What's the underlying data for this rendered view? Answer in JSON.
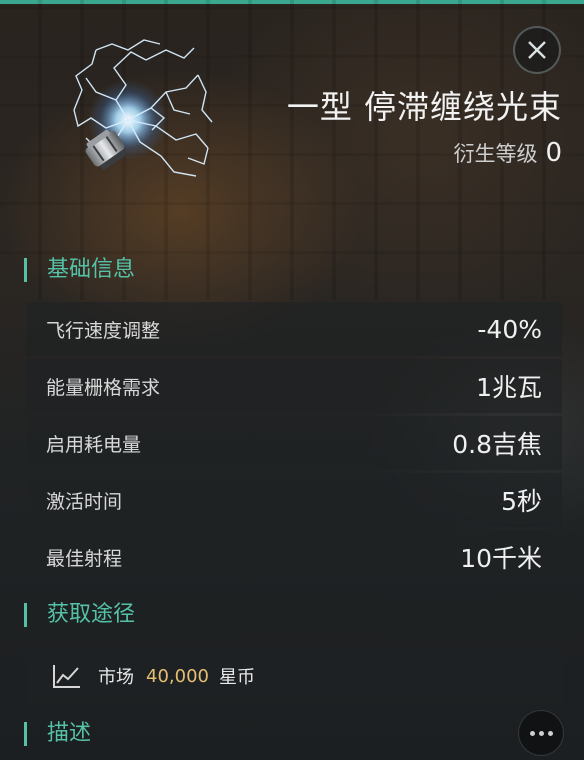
{
  "item": {
    "name": "一型 停滞缠绕光束",
    "derive_label": "衍生等级",
    "derive_level": "0",
    "icon": "stasis-webifier-icon"
  },
  "sections": {
    "basic": "基础信息",
    "source": "获取途径",
    "description": "描述"
  },
  "stats": [
    {
      "label": "飞行速度调整",
      "value": "-40%"
    },
    {
      "label": "能量栅格需求",
      "value": "1兆瓦"
    },
    {
      "label": "启用耗电量",
      "value": "0.8吉焦"
    },
    {
      "label": "激活时间",
      "value": "5秒"
    },
    {
      "label": "最佳射程",
      "value": "10千米"
    }
  ],
  "acquisition": {
    "market_label": "市场",
    "price": "40,000",
    "currency": "星币",
    "icon": "market-chart-icon"
  },
  "controls": {
    "close_icon": "close-icon",
    "more_icon": "more-icon"
  },
  "colors": {
    "accent": "#55c2a8",
    "price": "#e4bf72",
    "top_bar": "#3aa88f"
  }
}
